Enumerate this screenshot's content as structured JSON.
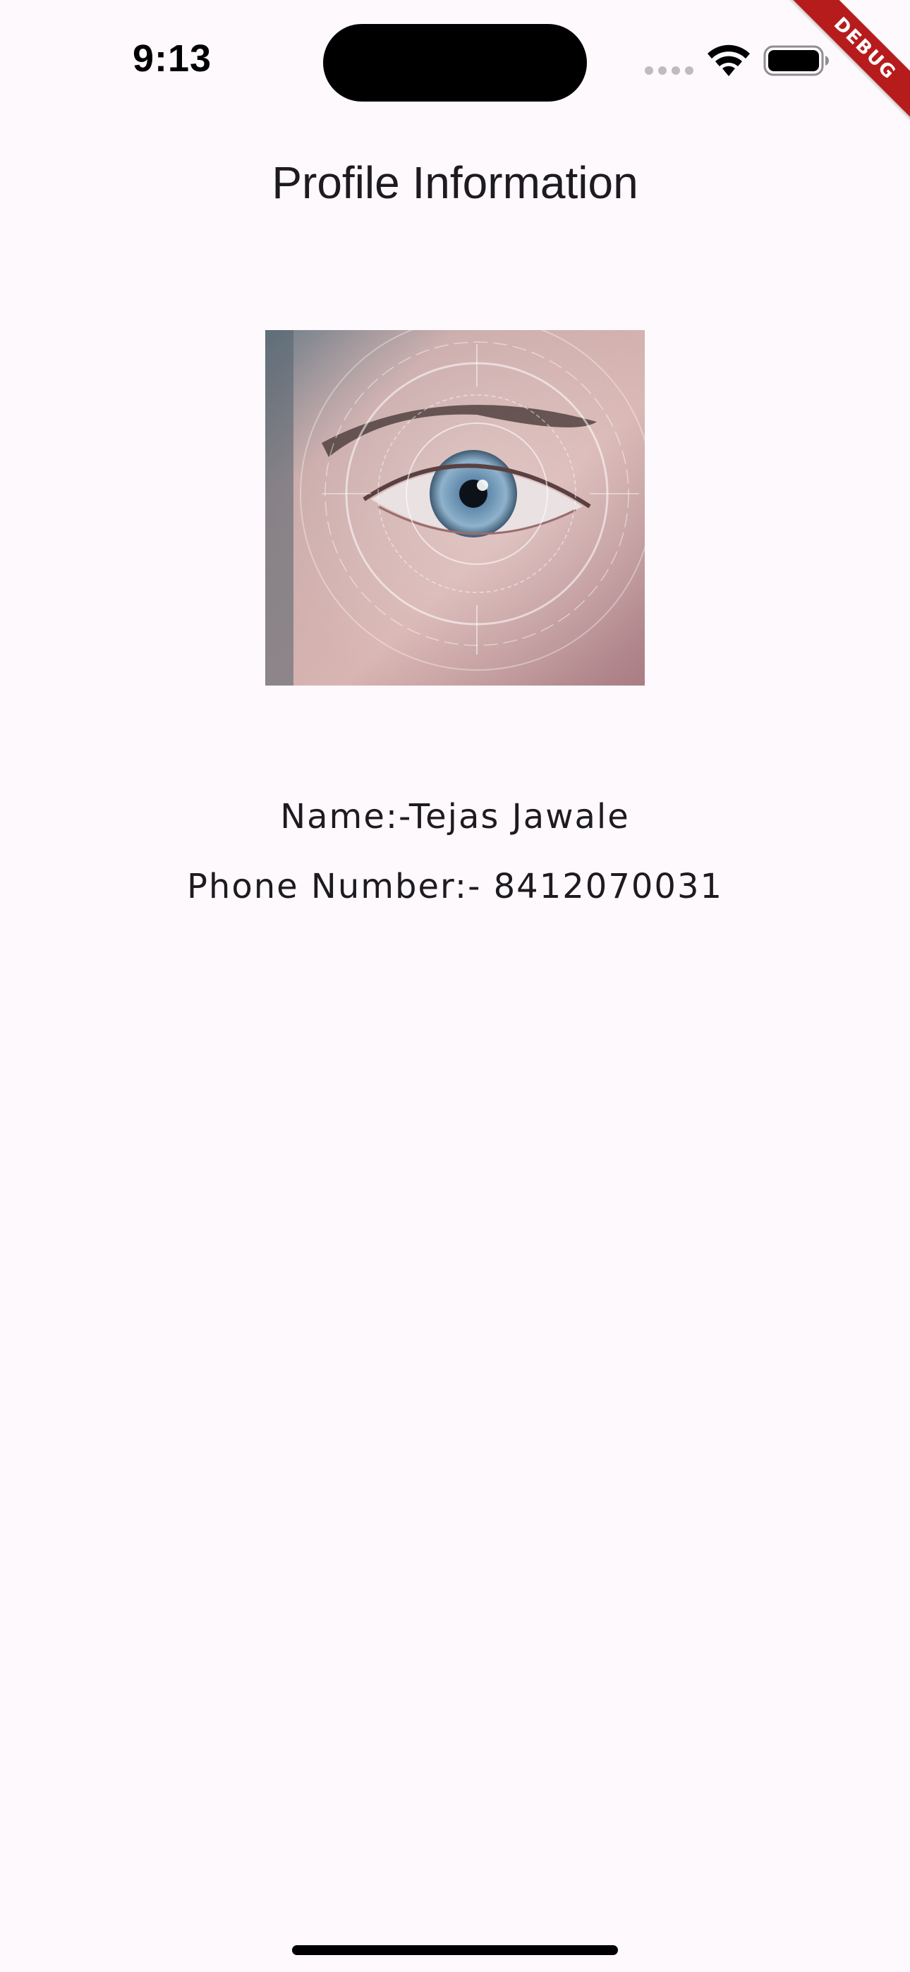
{
  "status_bar": {
    "time": "9:13",
    "wifi_icon": "wifi-icon",
    "battery_icon": "battery-icon",
    "signal_icon": "cellular-signal-icon"
  },
  "debug_banner": {
    "label": "DEBUG",
    "color": "#b71c1c"
  },
  "header": {
    "title": "Profile Information"
  },
  "profile": {
    "image_subject": "eye-scan-image",
    "name_line": "Name:-Tejas Jawale",
    "phone_line": "Phone Number:- 8412070031"
  },
  "colors": {
    "background": "#fdf9fc",
    "text": "#1d1b20"
  }
}
